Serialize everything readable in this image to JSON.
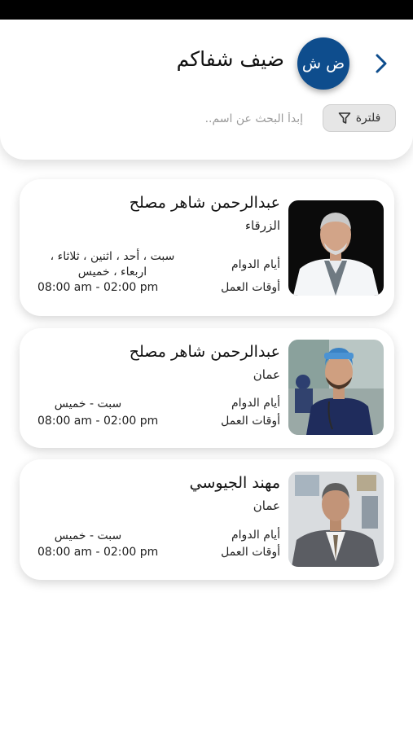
{
  "header": {
    "avatar_initials": "ض ش",
    "guest_name": "ضيف شفاكم",
    "filter_label": "فلترة",
    "search_placeholder": "إبدأ البحث عن اسم..",
    "accent_color": "#0e4d8d"
  },
  "labels": {
    "work_days": "أيام الدوام",
    "work_hours": "أوقات العمل"
  },
  "doctors": [
    {
      "name": "عبدالرحمن شاهر مصلح",
      "city": "الزرقاء",
      "days": "سبت ، أحد ، اثنين ، ثلاثاء ، اربعاء ، خميس",
      "hours": "08:00 am - 02:00 pm"
    },
    {
      "name": "عبدالرحمن شاهر مصلح",
      "city": "عمان",
      "days": "سبت - خميس",
      "hours": "08:00 am - 02:00 pm"
    },
    {
      "name": "مهند الجيوسي",
      "city": "عمان",
      "days": "سبت - خميس",
      "hours": "08:00 am - 02:00 pm"
    }
  ]
}
